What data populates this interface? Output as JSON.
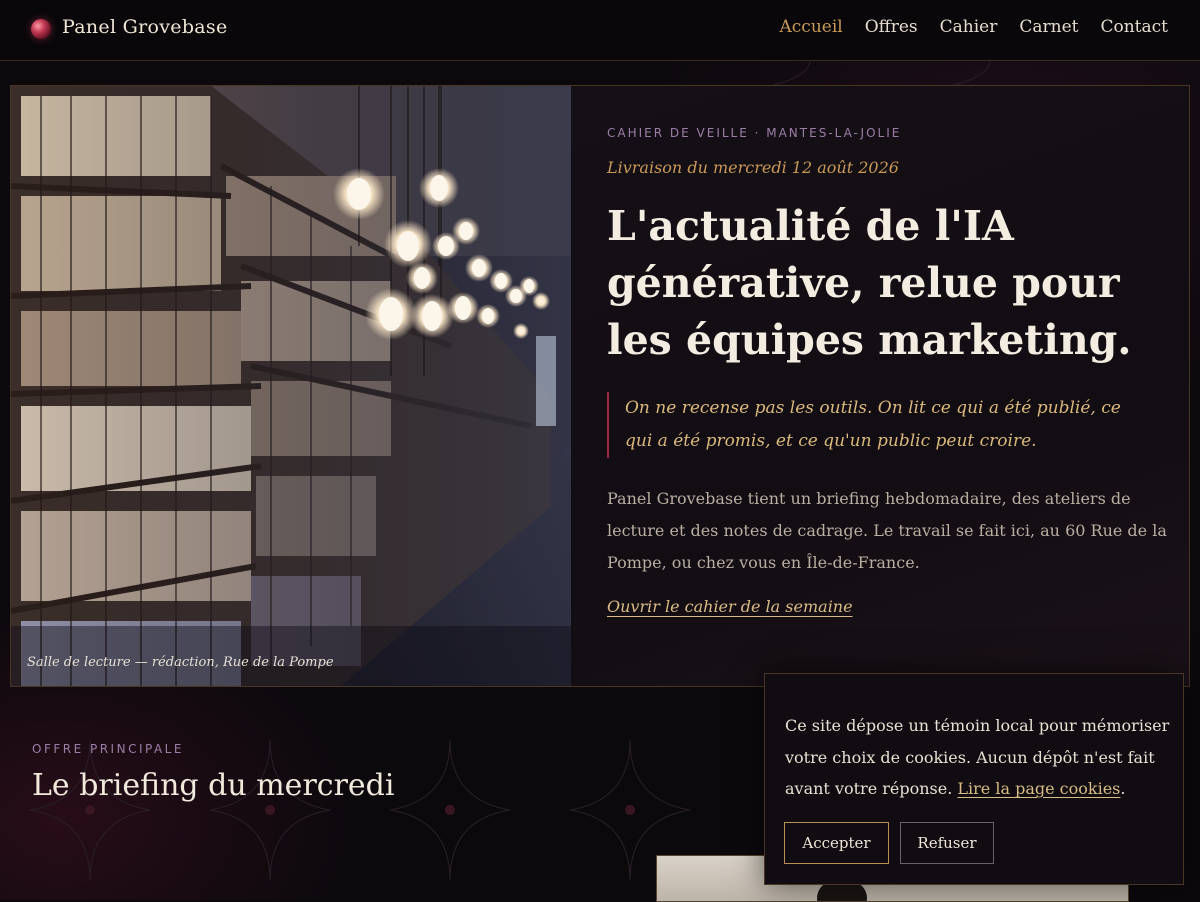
{
  "header": {
    "brand": "Panel Grovebase",
    "nav": [
      {
        "label": "Accueil",
        "active": true
      },
      {
        "label": "Offres",
        "active": false
      },
      {
        "label": "Cahier",
        "active": false
      },
      {
        "label": "Carnet",
        "active": false
      },
      {
        "label": "Contact",
        "active": false
      }
    ]
  },
  "hero": {
    "photo_caption": "Salle de lecture — rédaction, Rue de la Pompe",
    "kicker": "CAHIER DE VEILLE · MANTES-LA-JOLIE",
    "edition_date": "Livraison du mercredi 12 août 2026",
    "title": "L'actualité de l'IA générative, relue pour les équipes marketing.",
    "quote": "On ne recense pas les outils. On lit ce qui a été publié, ce qui a été promis, et ce qu'un public peut croire.",
    "body": "Panel Grovebase tient un briefing hebdomadaire, des ateliers de lecture et des notes de cadrage. Le travail se fait ici, au 60 Rue de la Pompe, ou chez vous en Île-de-France.",
    "cta": "Ouvrir le cahier de la semaine"
  },
  "offer": {
    "kicker": "OFFRE PRINCIPALE",
    "title": "Le briefing du mercredi"
  },
  "cookie": {
    "text": "Ce site dépose un témoin local pour mémoriser votre choix de cookies. Aucun dépôt n'est fait avant votre réponse.",
    "link": "Lire la page cookies",
    "after_link": ".",
    "accept": "Accepter",
    "refuse": "Refuser"
  },
  "colors": {
    "accent_gold": "#c99a57",
    "accent_violet": "#9b7ea6",
    "accent_red": "#9a2a3e",
    "background": "#0c090d"
  },
  "icons": {
    "brand": "brand-orb-icon"
  }
}
